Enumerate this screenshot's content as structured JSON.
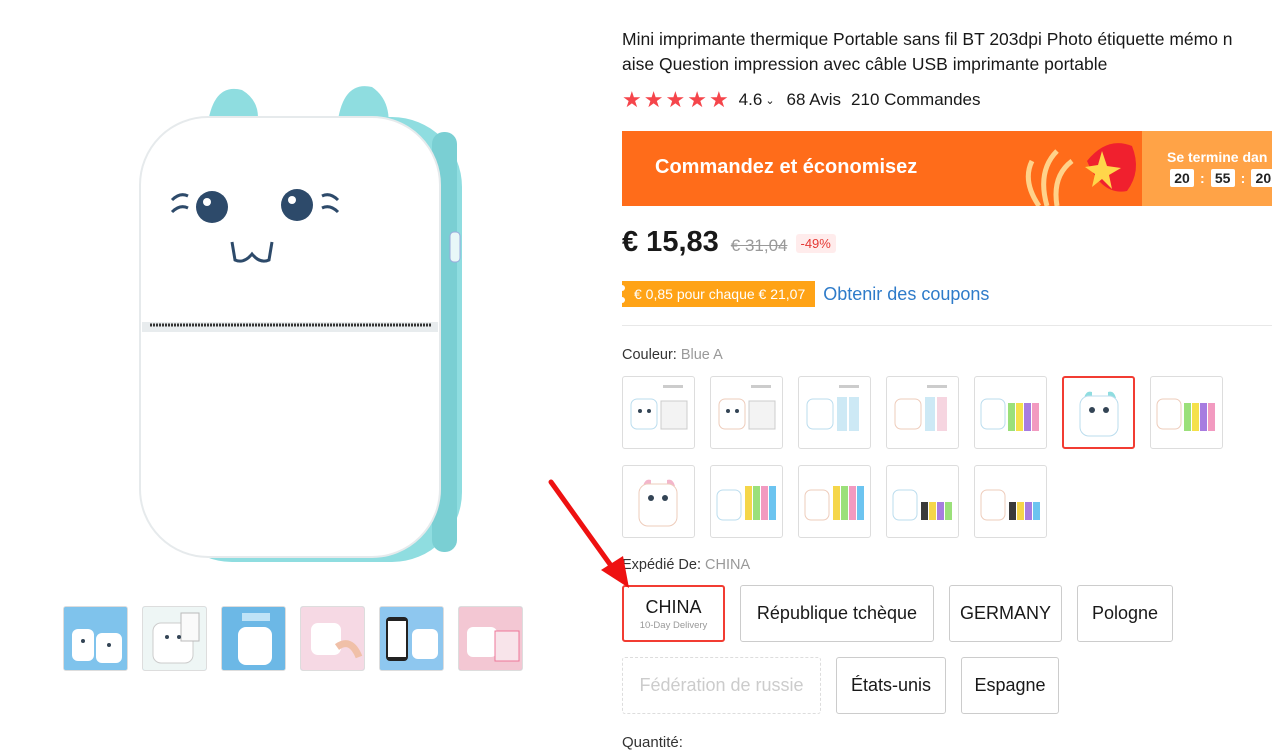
{
  "product": {
    "title_line1": "Mini imprimante thermique Portable sans fil BT 203dpi Photo étiquette mémo n",
    "title_line2": "aise Question impression avec câble USB imprimante portable",
    "rating": "4.6",
    "rating_chevron": "⌄",
    "reviews": "68 Avis",
    "orders": "210 Commandes",
    "stars": 5
  },
  "banner": {
    "text": "Commandez et économisez",
    "ends_label": "Se termine dan",
    "timer": [
      "20",
      "55",
      "20"
    ],
    "colors": {
      "bg": "#ff6c1a",
      "right_bg": "#ffa347"
    }
  },
  "price": {
    "current": "€ 15,83",
    "original": "€ 31,04",
    "discount": "-49%"
  },
  "coupon": {
    "tag": "€ 0,85 pour chaque € 21,07",
    "link": "Obtenir des coupons"
  },
  "color": {
    "label": "Couleur:",
    "value": "Blue A",
    "options": [
      {
        "variant": "blue-printer-paper"
      },
      {
        "variant": "pink-printer-paper"
      },
      {
        "variant": "blue-printer-rolls"
      },
      {
        "variant": "pink-printer-rolls"
      },
      {
        "variant": "blue-printer-color-rolls"
      },
      {
        "variant": "blue-printer",
        "selected": true
      },
      {
        "variant": "pink-printer-color-rolls"
      },
      {
        "variant": "pink-printer"
      },
      {
        "variant": "blue-printer-yellow-rolls"
      },
      {
        "variant": "pink-printer-yellow-rolls"
      },
      {
        "variant": "blue-printer-mixed-rolls"
      },
      {
        "variant": "pink-printer-mixed-rolls"
      }
    ]
  },
  "shipping": {
    "label": "Expédié De:",
    "value": "CHINA",
    "options": [
      {
        "name": "CHINA",
        "sub": "10-Day Delivery",
        "selected": true
      },
      {
        "name": "République tchèque"
      },
      {
        "name": "GERMANY"
      },
      {
        "name": "Pologne"
      },
      {
        "name": "Fédération de russie",
        "disabled": true
      },
      {
        "name": "États-unis"
      },
      {
        "name": "Espagne"
      }
    ]
  },
  "quantity": {
    "label": "Quantité:"
  },
  "theme": {
    "accent": "#f23c32",
    "star": "#f5454b",
    "link": "#2e7bc9",
    "mint": "#8fdde0"
  }
}
